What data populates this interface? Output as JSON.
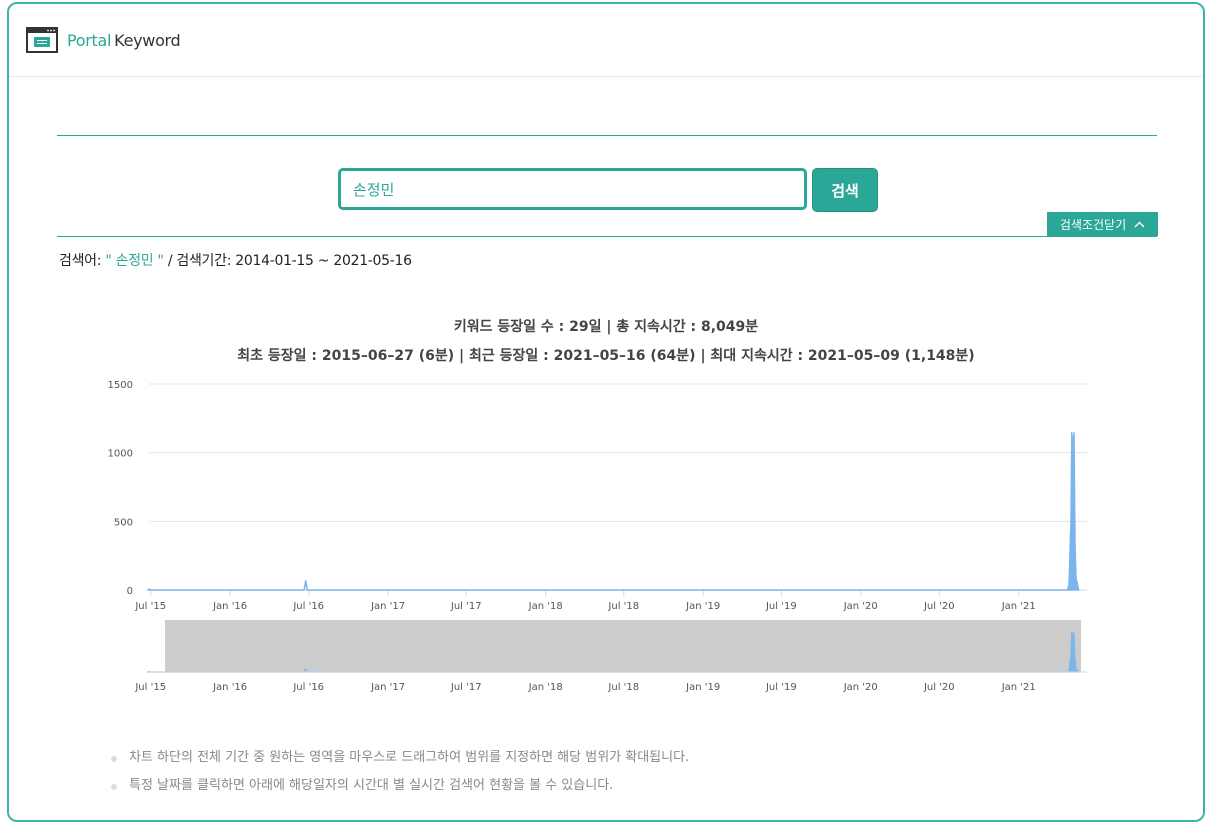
{
  "header": {
    "brand_part1": "Portal",
    "brand_part2": "Keyword",
    "logo_icon": "browser-window-icon",
    "accent_color": "#2aa796"
  },
  "search": {
    "value": "손정민",
    "button_label": "검색",
    "toggle_label": "검색조건닫기",
    "toggle_icon": "chevron-up-icon"
  },
  "conditions": {
    "keyword_label": "검색어:",
    "keyword_value": "\" 손정민 \"",
    "period_label": "/ 검색기간:",
    "period_value": "2014-01-15 ~ 2021-05-16"
  },
  "stats": {
    "line1": "키워드 등장일 수 : 29일 | 총 지속시간 : 8,049분",
    "line2": "최초 등장일 : 2015–06–27 (6분) | 최근 등장일 : 2021–05–16 (64분) | 최대 지속시간 : 2021–05–09 (1,148분)"
  },
  "chart_data": {
    "type": "area",
    "x_start": "2015-06-27",
    "x_end": "2021-05-16",
    "x_tick_labels": [
      "Jul '15",
      "Jan '16",
      "Jul '16",
      "Jan '17",
      "Jul '17",
      "Jan '18",
      "Jul '18",
      "Jan '19",
      "Jul '19",
      "Jan '20",
      "Jul '20",
      "Jan '21"
    ],
    "x_tick_dates": [
      "2015-07-01",
      "2016-01-01",
      "2016-07-01",
      "2017-01-01",
      "2017-07-01",
      "2018-01-01",
      "2018-07-01",
      "2019-01-01",
      "2019-07-01",
      "2020-01-01",
      "2020-07-01",
      "2021-01-01"
    ],
    "y_tick_labels": [
      "0",
      "500",
      "1000",
      "1500"
    ],
    "ylim": [
      0,
      1500
    ],
    "series_color": "#7cb5ec",
    "navigator_mask_color": "#cccccc",
    "points": [
      {
        "x": "2015-06-27",
        "y": 6
      },
      {
        "x": "2016-06-24",
        "y": 70
      },
      {
        "x": "2021-04-27",
        "y": 30
      },
      {
        "x": "2021-04-30",
        "y": 210
      },
      {
        "x": "2021-05-01",
        "y": 420
      },
      {
        "x": "2021-05-03",
        "y": 700
      },
      {
        "x": "2021-05-04",
        "y": 1150
      },
      {
        "x": "2021-05-05",
        "y": 560
      },
      {
        "x": "2021-05-06",
        "y": 1120
      },
      {
        "x": "2021-05-07",
        "y": 520
      },
      {
        "x": "2021-05-09",
        "y": 1148
      },
      {
        "x": "2021-05-11",
        "y": 380
      },
      {
        "x": "2021-05-13",
        "y": 120
      },
      {
        "x": "2021-05-16",
        "y": 64
      }
    ]
  },
  "notes": [
    "차트 하단의 전체 기간 중 원하는 영역을 마우스로 드래그하여 범위를 지정하면 해당 범위가 확대됩니다.",
    "특정 날짜를 클릭하면 아래에 해당일자의 시간대 별 실시간 검색어 현황을 볼 수 있습니다."
  ]
}
